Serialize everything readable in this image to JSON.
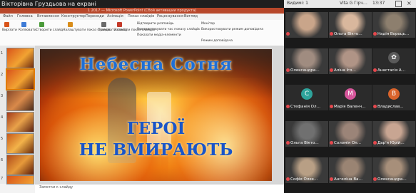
{
  "share_label": "Вікторівна Груздьова на екрані",
  "powerpoint": {
    "window_title": "1 2017 — Microsoft PowerPoint (Сбой активации продукта)",
    "tabs": [
      "Файл",
      "Головна",
      "Вставлення",
      "Конструктор",
      "Переходи",
      "Анімація",
      "Показ слайдів",
      "Рецензування",
      "Вигляд"
    ],
    "ribbon_items": [
      "Вирізати",
      "Копіювати",
      "Створити слайд",
      "Налаштувати показ слайдів",
      "Приховати слайд",
      "Записати показ слайдів",
      "Відтворити розповідь",
      "Використовувати час показу слайдів",
      "Показати медіа-елементи",
      "Монітор",
      "Використовувати режим доповідача",
      "Режим доповідача"
    ],
    "slide_numbers": [
      "1",
      "2",
      "3",
      "4",
      "5",
      "6",
      "7",
      "8"
    ],
    "slide": {
      "title": "Небесна  Сотня",
      "line2": "ГЕРОЇ",
      "line3": "НЕ ВМИРАЮТЬ"
    },
    "notes_placeholder": "Заметки к слайду"
  },
  "window_bar": {
    "left_text": "Видимі: 1",
    "center_text": "Vita G Гірч…",
    "time": "13:37"
  },
  "participants": [
    {
      "name": "",
      "avatar": "",
      "kind": "photo",
      "color": "#c9a58a"
    },
    {
      "name": "Ольга Вікто…",
      "avatar": "",
      "kind": "photo",
      "color": "#d9b79d"
    },
    {
      "name": "Надія Вороць…",
      "avatar": "",
      "kind": "photo",
      "color": "#8d7f6e"
    },
    {
      "name": "Олександра…",
      "avatar": "",
      "kind": "photo",
      "color": "#a08c80"
    },
    {
      "name": "Аліна Іго…",
      "avatar": "",
      "kind": "photo",
      "color": "#b09486"
    },
    {
      "name": "Анастасія А…",
      "avatar": "✿",
      "kind": "avatar",
      "color": "#5a5a5a"
    },
    {
      "name": "Стефанія Ол…",
      "avatar": "C",
      "kind": "avatar",
      "color": "#2ea39b"
    },
    {
      "name": "Марія Валенч…",
      "avatar": "M",
      "kind": "avatar",
      "color": "#d6569b"
    },
    {
      "name": "Владислав…",
      "avatar": "B",
      "kind": "avatar",
      "color": "#d9632b"
    },
    {
      "name": "Ольга Вікто…",
      "avatar": "",
      "kind": "photo",
      "color": "#707070"
    },
    {
      "name": "Соломія Ол…",
      "avatar": "",
      "kind": "photo",
      "color": "#9b8478"
    },
    {
      "name": "Дар'я Юрій…",
      "avatar": "",
      "kind": "photo",
      "color": "#c8a592"
    },
    {
      "name": "Софія Олек…",
      "avatar": "",
      "kind": "photo",
      "color": "#b89f85"
    },
    {
      "name": "Ангеліна Ва…",
      "avatar": "",
      "kind": "photo",
      "color": "#9a8473"
    },
    {
      "name": "Олександра…",
      "avatar": "",
      "kind": "photo",
      "color": "#a78f7a"
    }
  ]
}
